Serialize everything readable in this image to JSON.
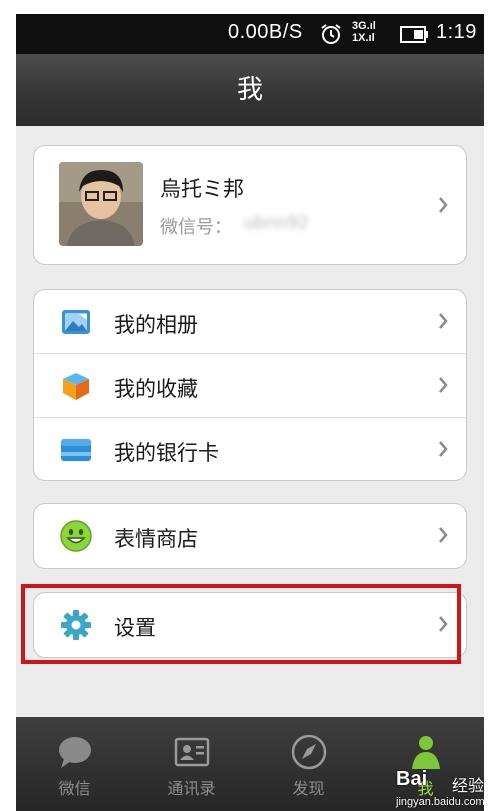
{
  "status_bar": {
    "network_speed": "0.00B/S",
    "signal_top": "3G.ıl",
    "signal_bottom": "1X.ıl",
    "time": "1:19",
    "icons": [
      "alarm-icon",
      "battery-icon"
    ]
  },
  "header": {
    "title": "我"
  },
  "profile": {
    "name": "烏托ミ邦",
    "wechat_id_label": "微信号：",
    "wechat_id_value": "ubnn92"
  },
  "menu_group": {
    "items": [
      {
        "label": "我的相册",
        "icon": "photo-album-icon"
      },
      {
        "label": "我的收藏",
        "icon": "favorites-cube-icon"
      },
      {
        "label": "我的银行卡",
        "icon": "bank-card-icon"
      }
    ]
  },
  "sticker_store": {
    "label": "表情商店",
    "icon": "smiley-icon"
  },
  "settings": {
    "label": "设置",
    "icon": "gear-icon"
  },
  "tabs": [
    {
      "label": "微信",
      "icon": "chat-bubble-icon",
      "active": false
    },
    {
      "label": "通讯录",
      "icon": "contacts-card-icon",
      "active": false
    },
    {
      "label": "发现",
      "icon": "compass-icon",
      "active": false
    },
    {
      "label": "我",
      "icon": "person-icon",
      "active": true
    }
  ],
  "watermark": {
    "brand": "Bai",
    "suffix": "经验",
    "url": "jingyan.baidu.com"
  },
  "colors": {
    "highlight": "#d0141c",
    "active_tab": "#9adf4a",
    "title_bar": "#343434"
  }
}
